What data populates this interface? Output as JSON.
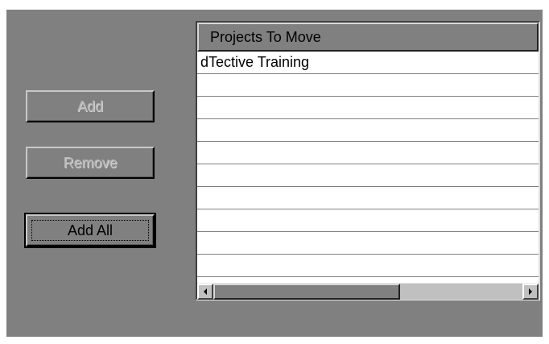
{
  "buttons": {
    "add_label": "Add",
    "remove_label": "Remove",
    "add_all_label": "Add All"
  },
  "list": {
    "column_header": "Projects To Move",
    "rows": [
      "dTective Training",
      "",
      "",
      "",
      "",
      "",
      "",
      "",
      "",
      ""
    ]
  },
  "scrollbar": {
    "left_arrow_icon": "triangle-left-icon",
    "right_arrow_icon": "triangle-right-icon"
  },
  "colors": {
    "dialog_bg": "#808080",
    "list_bg": "#ffffff",
    "disabled_text": "#b4b4b4"
  }
}
